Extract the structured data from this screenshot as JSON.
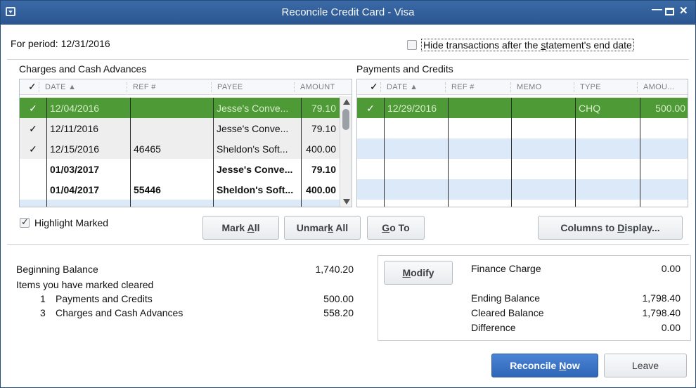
{
  "window": {
    "title": "Reconcile Credit Card - Visa"
  },
  "period": "For period: 12/31/2016",
  "hide_transactions": {
    "label_pre": "Hide transactions after the ",
    "label_key": "s",
    "label_post": "tatement's end date",
    "checked": false
  },
  "charges": {
    "title": "Charges and Cash Advances",
    "headers": {
      "check": "✓",
      "date": "DATE ▲",
      "ref": "REF #",
      "payee": "PAYEE",
      "amount": "AMOUNT"
    },
    "rows": [
      {
        "check": "✓",
        "date": "12/04/2016",
        "ref": "",
        "payee": "Jesse's Conve...",
        "amount": "79.10"
      },
      {
        "check": "✓",
        "date": "12/11/2016",
        "ref": "",
        "payee": "Jesse's Conve...",
        "amount": "79.10"
      },
      {
        "check": "✓",
        "date": "12/15/2016",
        "ref": "46465",
        "payee": "Sheldon's Soft...",
        "amount": "400.00"
      },
      {
        "check": "",
        "date": "01/03/2017",
        "ref": "",
        "payee": "Jesse's Conve...",
        "amount": "79.10"
      },
      {
        "check": "",
        "date": "01/04/2017",
        "ref": "55446",
        "payee": "Sheldon's Soft...",
        "amount": "400.00"
      }
    ]
  },
  "payments": {
    "title": "Payments and Credits",
    "headers": {
      "check": "✓",
      "date": "DATE ▲",
      "ref": "REF #",
      "memo": "MEMO",
      "type": "TYPE",
      "amount": "AMOU..."
    },
    "rows": [
      {
        "check": "✓",
        "date": "12/29/2016",
        "ref": "",
        "memo": "",
        "type": "CHQ",
        "amount": "500.00"
      }
    ]
  },
  "highlight_marked": {
    "label": "Highlight Marked",
    "checked": true
  },
  "buttons": {
    "mark_all_pre": "Mark ",
    "mark_all_key": "A",
    "mark_all_post": "ll",
    "unmark_all_pre": "Unmar",
    "unmark_all_key": "k",
    "unmark_all_post": " All",
    "go_to_key": "G",
    "go_to_post": "o To",
    "columns_pre": "Columns to ",
    "columns_key": "D",
    "columns_post": "isplay...",
    "modify_key": "M",
    "modify_post": "odify",
    "reconcile_pre": "Reconcile ",
    "reconcile_key": "N",
    "reconcile_post": "ow",
    "leave": "Leave"
  },
  "summary": {
    "beginning_balance_label": "Beginning Balance",
    "beginning_balance_value": "1,740.20",
    "items_marked_label": "Items you have marked cleared",
    "payments_count": "1",
    "payments_label": "Payments and Credits",
    "payments_value": "500.00",
    "charges_count": "3",
    "charges_label": "Charges and Cash Advances",
    "charges_value": "558.20"
  },
  "balances": {
    "finance_charge_label": "Finance Charge",
    "finance_charge_value": "0.00",
    "ending_balance_label": "Ending Balance",
    "ending_balance_value": "1,798.40",
    "cleared_balance_label": "Cleared Balance",
    "cleared_balance_value": "1,798.40",
    "difference_label": "Difference",
    "difference_value": "0.00"
  }
}
